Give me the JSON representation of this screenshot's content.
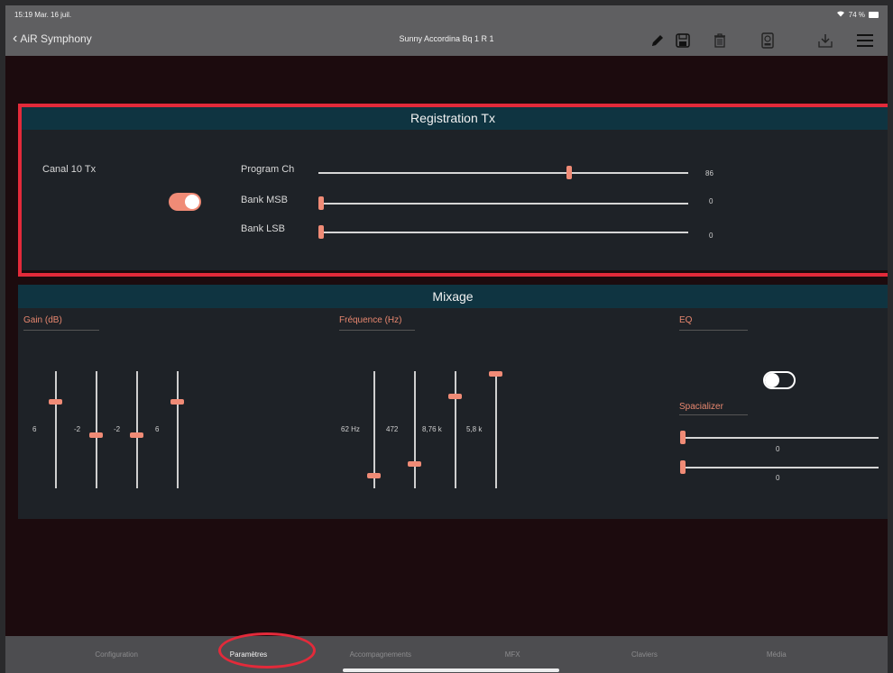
{
  "statusbar": {
    "time": "15:19  Mar. 16 juil.",
    "battery": "74 %",
    "wifi_icon": "wifi-icon"
  },
  "navbar": {
    "back_label": "AiR Symphony",
    "title": "Sunny Accordina Bq 1 R 1",
    "icons": [
      "pencil-icon",
      "save-icon",
      "trash-icon",
      "device-icon",
      "download-icon",
      "menu-icon"
    ]
  },
  "registration": {
    "header": "Registration Tx",
    "channel_label": "Canal 10 Tx",
    "channel_enabled": true,
    "sliders": [
      {
        "label": "Program Ch",
        "value": "86",
        "fraction": 0.68
      },
      {
        "label": "Bank MSB",
        "value": "0",
        "fraction": 0.0
      },
      {
        "label": "Bank LSB",
        "value": "0",
        "fraction": 0.0
      }
    ]
  },
  "mixage": {
    "header": "Mixage",
    "gain_title": "Gain (dB)",
    "gain_sliders": [
      {
        "value": "6",
        "fraction": 0.75
      },
      {
        "value": "-2",
        "fraction": 0.45
      },
      {
        "value": "-2",
        "fraction": 0.45
      },
      {
        "value": "6",
        "fraction": 0.75
      }
    ],
    "freq_title": "Fréquence (Hz)",
    "freq_sliders": [
      {
        "value": "62 Hz",
        "fraction": 0.09
      },
      {
        "value": "472",
        "fraction": 0.19
      },
      {
        "value": "8,76 k",
        "fraction": 0.8
      },
      {
        "value": "5,8 k",
        "fraction": 1.0
      }
    ],
    "eq_title": "EQ",
    "eq_enabled": false,
    "spacializer_title": "Spacializer",
    "spacializer_sliders": [
      {
        "value": "0",
        "fraction": 0.0
      },
      {
        "value": "0",
        "fraction": 0.0
      }
    ]
  },
  "tabbar": {
    "tabs": [
      "Configuration",
      "Paramètres",
      "Accompagnements",
      "MFX",
      "Claviers",
      "Média"
    ],
    "active": "Paramètres"
  },
  "colors": {
    "accent": "#f08b76",
    "highlight": "#e32a3a",
    "header_bg": "#0f3441"
  }
}
